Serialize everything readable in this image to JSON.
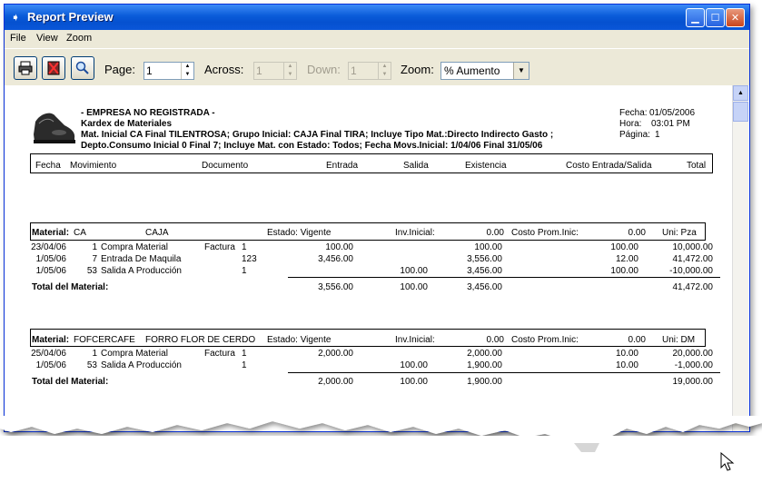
{
  "window": {
    "title": "Report Preview"
  },
  "menu": [
    "File",
    "View",
    "Zoom"
  ],
  "toolbar": {
    "page_label": "Page:",
    "page_value": "1",
    "across_label": "Across:",
    "across_value": "1",
    "down_label": "Down:",
    "down_value": "1",
    "zoom_label": "Zoom:",
    "zoom_value": "% Aumento"
  },
  "report": {
    "company": "- EMPRESA NO REGISTRADA -",
    "title": "Kardex de Materiales",
    "filter1": "Mat. Inicial CA Final TILENTROSA;    Grupo Inicial: CAJA Final TIRA;    Incluye Tipo Mat.:Directo Indirecto Gasto ;",
    "filter2": "Depto.Consumo Inicial 0 Final 7;    Incluye Mat. con Estado: Todos;    Fecha Movs.Inicial:  1/04/06 Final 31/05/06",
    "fecha_label": "Fecha:",
    "fecha_value": "01/05/2006",
    "hora_label": "Hora:",
    "hora_value": "03:01 PM",
    "pagina_label": "Página:",
    "pagina_value": "1",
    "columns": [
      "Fecha",
      "Movimiento",
      "Documento",
      "Entrada",
      "Salida",
      "Existencia",
      "Costo Entrada/Salida",
      "Total"
    ],
    "materials": [
      {
        "code": "CA",
        "name": "CAJA",
        "estado": "Estado: Vigente",
        "inv_label": "Inv.Inicial:",
        "inv_value": "0.00",
        "costo_label": "Costo Prom.Inic:",
        "costo_value": "0.00",
        "uni": "Uni: Pza",
        "rows": [
          {
            "fecha": "23/04/06",
            "num": "1",
            "mov": "Compra Material",
            "doc": "Factura",
            "docn": "1",
            "entrada": "100.00",
            "salida": "",
            "exist": "100.00",
            "costo": "100.00",
            "total": "10,000.00"
          },
          {
            "fecha": "1/05/06",
            "num": "7",
            "mov": "Entrada De Maquila",
            "doc": "",
            "docn": "123",
            "entrada": "3,456.00",
            "salida": "",
            "exist": "3,556.00",
            "costo": "12.00",
            "total": "41,472.00"
          },
          {
            "fecha": "1/05/06",
            "num": "53",
            "mov": "Salida A Producción",
            "doc": "",
            "docn": "1",
            "entrada": "",
            "salida": "100.00",
            "exist": "3,456.00",
            "costo": "100.00",
            "total": "-10,000.00"
          }
        ],
        "totals": {
          "entrada": "3,556.00",
          "salida": "100.00",
          "exist": "3,456.00",
          "total": "41,472.00"
        }
      },
      {
        "code": "FOFCERCAFE",
        "name": "FORRO FLOR DE CERDO",
        "estado": "Estado: Vigente",
        "inv_label": "Inv.Inicial:",
        "inv_value": "0.00",
        "costo_label": "Costo Prom.Inic:",
        "costo_value": "0.00",
        "uni": "Uni: DM",
        "rows": [
          {
            "fecha": "25/04/06",
            "num": "1",
            "mov": "Compra Material",
            "doc": "Factura",
            "docn": "1",
            "entrada": "2,000.00",
            "salida": "",
            "exist": "2,000.00",
            "costo": "10.00",
            "total": "20,000.00"
          },
          {
            "fecha": "1/05/06",
            "num": "53",
            "mov": "Salida A Producción",
            "doc": "",
            "docn": "1",
            "entrada": "",
            "salida": "100.00",
            "exist": "1,900.00",
            "costo": "10.00",
            "total": "-1,000.00"
          }
        ],
        "totals": {
          "entrada": "2,000.00",
          "salida": "100.00",
          "exist": "1,900.00",
          "total": "19,000.00"
        }
      }
    ],
    "material_label": "Material:",
    "total_label": "Total del Material:"
  }
}
